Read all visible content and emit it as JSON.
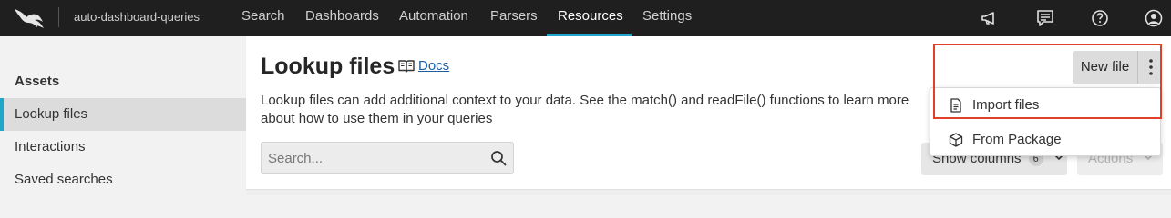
{
  "header": {
    "repo_name": "auto-dashboard-queries",
    "nav": [
      {
        "label": "Search"
      },
      {
        "label": "Dashboards"
      },
      {
        "label": "Automation"
      },
      {
        "label": "Parsers"
      },
      {
        "label": "Resources",
        "active": true
      },
      {
        "label": "Settings"
      }
    ],
    "icons": [
      "megaphone-icon",
      "feedback-icon",
      "help-icon",
      "account-icon"
    ],
    "accent_color": "#1ea7c9"
  },
  "sidebar": {
    "heading": "Assets",
    "items": [
      {
        "label": "Lookup files",
        "active": true
      },
      {
        "label": "Interactions"
      },
      {
        "label": "Saved searches"
      }
    ]
  },
  "main": {
    "title": "Lookup files",
    "docs_label": "Docs",
    "description": "Lookup files can add additional context to your data. See the match() and readFile() functions to learn more about how to use them in your queries",
    "search": {
      "placeholder": "Search...",
      "value": ""
    },
    "show_columns_label": "Show columns",
    "columns_count": "6",
    "actions_label": "Actions",
    "new_file_label": "New file",
    "dropdown": [
      {
        "label": "Import files",
        "icon": "file-icon"
      },
      {
        "label": "From Package",
        "icon": "package-icon"
      }
    ]
  },
  "highlight_color": "#e0402a"
}
